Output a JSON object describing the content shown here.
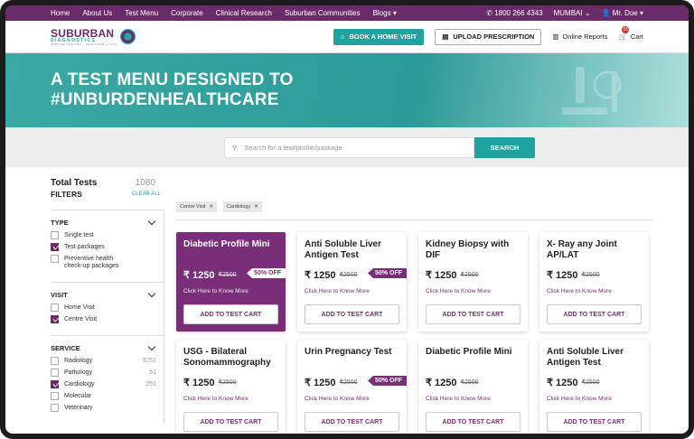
{
  "topnav": {
    "links": [
      "Home",
      "About Us",
      "Test Menu",
      "Corporate",
      "Clinical Research",
      "Suburban Communities",
      "Blogs"
    ],
    "phone": "1800 266 4343",
    "city": "MUMBAI",
    "user": "Mr. Doe"
  },
  "header": {
    "logo_main": "SUBURBAN",
    "logo_sub": "DIAGNOSTICS",
    "logo_tag": "PRECISE TESTING · HEALTHIER LIVING",
    "home_visit": "BOOK A HOME VISIT",
    "upload": "UPLOAD PRESCRIPTION",
    "online_reports": "Online Reports",
    "cart": "Cart",
    "cart_count": "01"
  },
  "hero": {
    "line1": "A TEST MENU DESIGNED TO",
    "line2": "#UNBURDENHEALTHCARE"
  },
  "search": {
    "placeholder": "Search for a test/profile/package",
    "button": "SEARCH"
  },
  "sidebar": {
    "total_label": "Total Tests",
    "total_count": "1080",
    "filters_label": "FILTERS",
    "clear_all": "CLEAR ALL",
    "sections": [
      {
        "title": "TYPE",
        "options": [
          {
            "label": "Single test",
            "checked": false,
            "count": ""
          },
          {
            "label": "Test packages",
            "checked": true,
            "count": ""
          },
          {
            "label": "Preventive health check-up packages",
            "checked": false,
            "count": ""
          }
        ]
      },
      {
        "title": "VISIT",
        "options": [
          {
            "label": "Home Visit",
            "checked": false,
            "count": ""
          },
          {
            "label": "Centre Visit",
            "checked": true,
            "count": ""
          }
        ]
      },
      {
        "title": "SERVICE",
        "options": [
          {
            "label": "Radiology",
            "checked": false,
            "count": "3251"
          },
          {
            "label": "Pathology",
            "checked": false,
            "count": "51"
          },
          {
            "label": "Cardiology",
            "checked": true,
            "count": "251"
          },
          {
            "label": "Molecular",
            "checked": false,
            "count": ""
          },
          {
            "label": "Veterinary",
            "checked": false,
            "count": ""
          }
        ]
      }
    ]
  },
  "chips": [
    "Centre Visit",
    "Cardiology"
  ],
  "cards": [
    {
      "title": "Diabetic Profile Mini",
      "price": "₹ 1250",
      "old": "₹2500",
      "badge": "50% OFF",
      "know": "Click Here to Know More",
      "add": "ADD TO TEST CART",
      "active": true
    },
    {
      "title": "Anti Soluble Liver Antigen Test",
      "price": "₹ 1250",
      "old": "₹2500",
      "badge": "50% OFF",
      "know": "Click Here to Know More",
      "add": "ADD TO TEST CART",
      "active": false
    },
    {
      "title": "Kidney Biopsy with DIF",
      "price": "₹ 1250",
      "old": "₹2500",
      "badge": "",
      "know": "Click Here to Know More",
      "add": "ADD TO TEST CART",
      "active": false
    },
    {
      "title": "X- Ray any Joint AP/LAT",
      "price": "₹ 1250",
      "old": "₹2500",
      "badge": "",
      "know": "Click Here to Know More",
      "add": "ADD TO TEST CART",
      "active": false
    },
    {
      "title": "USG - Bilateral Sonomammography",
      "price": "₹ 1250",
      "old": "₹2500",
      "badge": "",
      "know": "Click Here to Know More",
      "add": "ADD TO TEST CART",
      "active": false
    },
    {
      "title": "Urin Pregnancy Test",
      "price": "₹ 1250",
      "old": "₹2500",
      "badge": "50% OFF",
      "know": "Click Here to Know More",
      "add": "ADD TO TEST CART",
      "active": false
    },
    {
      "title": "Diabetic Profile Mini",
      "price": "₹ 1250",
      "old": "₹2500",
      "badge": "",
      "know": "Click Here to Know More",
      "add": "ADD TO TEST CART",
      "active": false
    },
    {
      "title": "Anti Soluble Liver Antigen Test",
      "price": "₹ 1250",
      "old": "₹2500",
      "badge": "",
      "know": "Click Here to Know More",
      "add": "ADD TO TEST CART",
      "active": false
    }
  ],
  "colors": {
    "brand_purple": "#6b2a6a",
    "teal": "#1fa3a1"
  }
}
